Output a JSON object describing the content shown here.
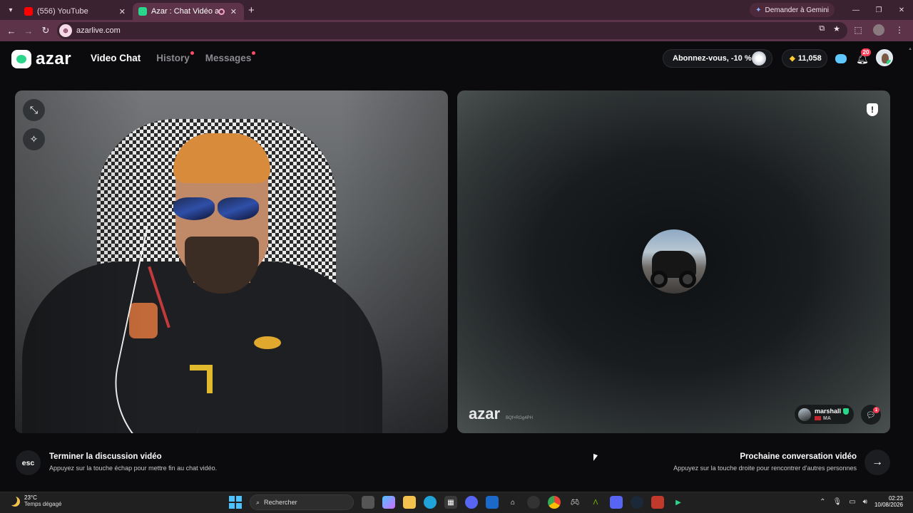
{
  "browser": {
    "tabs": [
      {
        "title": "(556) YouTube",
        "active": false,
        "favicon_color": "#ff0000"
      },
      {
        "title": "Azar : Chat Vidéo avec de n",
        "active": true,
        "favicon_color": "#2bd68a"
      }
    ],
    "new_tab": "+",
    "gemini_label": "Demander à Gemini",
    "url": "azarlive.com"
  },
  "app": {
    "logo_text": "azar",
    "nav": [
      {
        "label": "Video Chat",
        "active": true,
        "dot": false
      },
      {
        "label": "History",
        "active": false,
        "dot": true
      },
      {
        "label": "Messages",
        "active": false,
        "dot": true
      }
    ],
    "subscribe_label": "Abonnez-vous, -10 %",
    "gems_count": "11,058",
    "notification_count": "20"
  },
  "peer": {
    "watermark": "azar",
    "watermark_code": "BQf+RGg4PH",
    "username": "marshall",
    "country_code": "MA",
    "message_badge": "1"
  },
  "controls": {
    "esc_key": "esc",
    "end_title": "Terminer la discussion vidéo",
    "end_subtitle": "Appuyez sur la touche échap pour mettre fin au chat vidéo.",
    "next_title": "Prochaine conversation vidéo",
    "next_subtitle": "Appuyez sur la touche droite pour rencontrer d'autres personnes"
  },
  "taskbar": {
    "temperature": "23°C",
    "weather": "Temps dégagé",
    "search_placeholder": "Rechercher",
    "time": "02:23",
    "date": "10/08/2026"
  },
  "colors": {
    "accent_green": "#2bd68a",
    "alert_red": "#ff3b55",
    "browser_frame": "#5c3348"
  }
}
